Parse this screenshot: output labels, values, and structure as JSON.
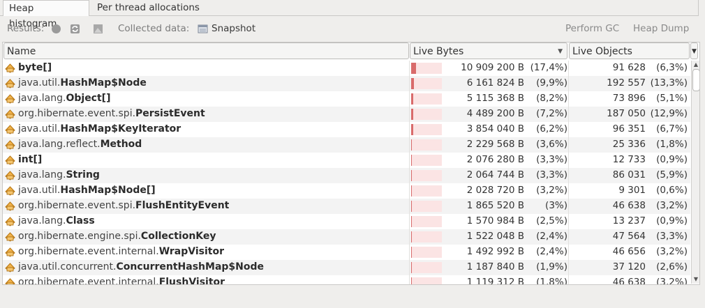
{
  "tabs": [
    {
      "label": "Heap histogram",
      "active": true
    },
    {
      "label": "Per thread allocations",
      "active": false
    }
  ],
  "toolbar": {
    "results_label": "Results:",
    "collected_label": "Collected data:",
    "snapshot_label": "Snapshot",
    "perform_gc_label": "Perform GC",
    "heap_dump_label": "Heap Dump"
  },
  "table": {
    "columns": {
      "name": "Name",
      "live_bytes": "Live Bytes",
      "live_objects": "Live Objects"
    },
    "rows": [
      {
        "pkg": "",
        "cls": "byte[]",
        "bytes": "10 909 200 B",
        "bytes_pct": "(17,4%)",
        "objects": "91 628",
        "objects_pct": "(6,3%)",
        "share": 0.174
      },
      {
        "pkg": "java.util.",
        "cls": "HashMap$Node",
        "bytes": "6 161 824 B",
        "bytes_pct": "(9,9%)",
        "objects": "192 557",
        "objects_pct": "(13,3%)",
        "share": 0.099
      },
      {
        "pkg": "java.lang.",
        "cls": "Object[]",
        "bytes": "5 115 368 B",
        "bytes_pct": "(8,2%)",
        "objects": "73 896",
        "objects_pct": "(5,1%)",
        "share": 0.082
      },
      {
        "pkg": "org.hibernate.event.spi.",
        "cls": "PersistEvent",
        "bytes": "4 489 200 B",
        "bytes_pct": "(7,2%)",
        "objects": "187 050",
        "objects_pct": "(12,9%)",
        "share": 0.072
      },
      {
        "pkg": "java.util.",
        "cls": "HashMap$KeyIterator",
        "bytes": "3 854 040 B",
        "bytes_pct": "(6,2%)",
        "objects": "96 351",
        "objects_pct": "(6,7%)",
        "share": 0.062
      },
      {
        "pkg": "java.lang.reflect.",
        "cls": "Method",
        "bytes": "2 229 568 B",
        "bytes_pct": "(3,6%)",
        "objects": "25 336",
        "objects_pct": "(1,8%)",
        "share": 0.036
      },
      {
        "pkg": "",
        "cls": "int[]",
        "bytes": "2 076 280 B",
        "bytes_pct": "(3,3%)",
        "objects": "12 733",
        "objects_pct": "(0,9%)",
        "share": 0.033
      },
      {
        "pkg": "java.lang.",
        "cls": "String",
        "bytes": "2 064 744 B",
        "bytes_pct": "(3,3%)",
        "objects": "86 031",
        "objects_pct": "(5,9%)",
        "share": 0.033
      },
      {
        "pkg": "java.util.",
        "cls": "HashMap$Node[]",
        "bytes": "2 028 720 B",
        "bytes_pct": "(3,2%)",
        "objects": "9 301",
        "objects_pct": "(0,6%)",
        "share": 0.032
      },
      {
        "pkg": "org.hibernate.event.spi.",
        "cls": "FlushEntityEvent",
        "bytes": "1 865 520 B",
        "bytes_pct": "(3%)",
        "objects": "46 638",
        "objects_pct": "(3,2%)",
        "share": 0.03
      },
      {
        "pkg": "java.lang.",
        "cls": "Class",
        "bytes": "1 570 984 B",
        "bytes_pct": "(2,5%)",
        "objects": "13 237",
        "objects_pct": "(0,9%)",
        "share": 0.025
      },
      {
        "pkg": "org.hibernate.engine.spi.",
        "cls": "CollectionKey",
        "bytes": "1 522 048 B",
        "bytes_pct": "(2,4%)",
        "objects": "47 564",
        "objects_pct": "(3,3%)",
        "share": 0.024
      },
      {
        "pkg": "org.hibernate.event.internal.",
        "cls": "WrapVisitor",
        "bytes": "1 492 992 B",
        "bytes_pct": "(2,4%)",
        "objects": "46 656",
        "objects_pct": "(3,2%)",
        "share": 0.024
      },
      {
        "pkg": "java.util.concurrent.",
        "cls": "ConcurrentHashMap$Node",
        "bytes": "1 187 840 B",
        "bytes_pct": "(1,9%)",
        "objects": "37 120",
        "objects_pct": "(2,6%)",
        "share": 0.019
      },
      {
        "pkg": "org.hibernate.event.internal.",
        "cls": "FlushVisitor",
        "bytes": "1 119 312 B",
        "bytes_pct": "(1,8%)",
        "objects": "46 638",
        "objects_pct": "(3,2%)",
        "share": 0.018
      }
    ]
  },
  "colors": {
    "bar_fill": "#d96b6b",
    "bar_bg": "#fbe4e4",
    "row_alt": "#f3f3f3"
  }
}
